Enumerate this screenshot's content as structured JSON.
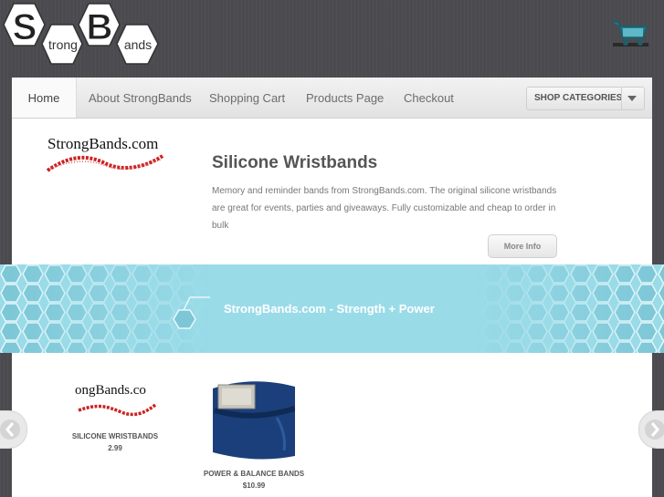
{
  "logo": {
    "letter_s": "S",
    "word_trong": "trong",
    "letter_b": "B",
    "word_ands": "ands"
  },
  "nav": {
    "items": [
      "Home",
      "About StrongBands",
      "Shopping Cart",
      "Products Page",
      "Checkout"
    ],
    "shop_categories": "SHOP CATEGORIES"
  },
  "hero": {
    "logo_text": "StrongBands.com",
    "title": "Silicone Wristbands",
    "description": "Memory and reminder bands from StrongBands.com. The original silicone wristbands are great for events, parties and giveaways. Fully customizable and cheap to order in bulk",
    "more_info": "More Info"
  },
  "banner": {
    "text": "StrongBands.com - Strength + Power"
  },
  "products": [
    {
      "thumb_text": "ongBands.co",
      "name": "SILICONE WRISTBANDS",
      "price": "2.99"
    },
    {
      "name": "POWER & BALANCE BANDS",
      "price": "$10.99"
    }
  ],
  "colors": {
    "banner": "#9adbe8",
    "hex": "#7cc6d6",
    "brand_red": "#cc2222",
    "band_blue": "#1b3f7a"
  },
  "icons": [
    "shopping-cart-icon",
    "chevron-down-icon",
    "chevron-left-icon",
    "chevron-right-icon"
  ]
}
